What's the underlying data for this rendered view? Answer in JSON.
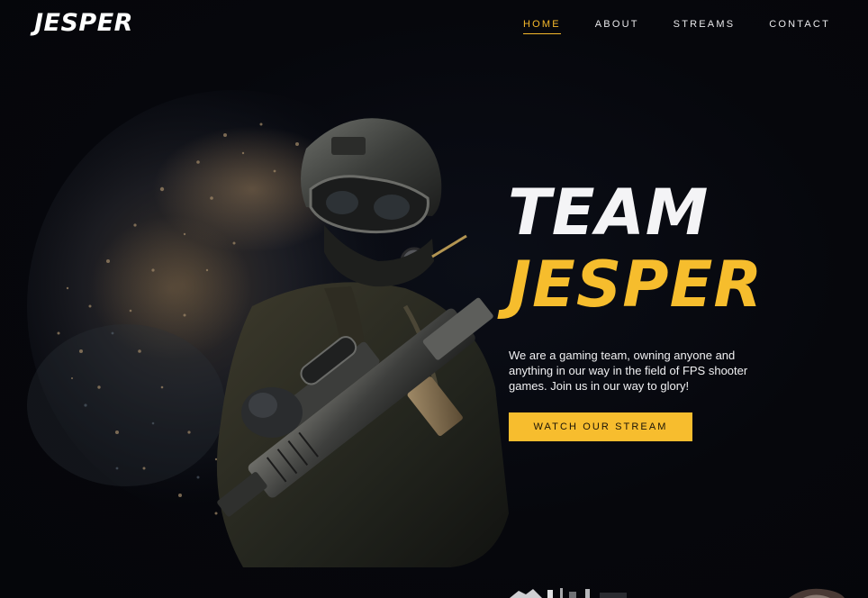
{
  "brand": {
    "logo_text": "JESPER"
  },
  "nav": {
    "items": [
      {
        "label": "HOME",
        "active": true
      },
      {
        "label": "ABOUT",
        "active": false
      },
      {
        "label": "STREAMS",
        "active": false
      },
      {
        "label": "CONTACT",
        "active": false
      }
    ]
  },
  "hero": {
    "title_line1": "TEAM",
    "title_line2": "JESPER",
    "description": "We are a gaming team, owning anyone and anything in our way in the field of FPS shooter games. Join us in our way to glory!",
    "cta_label": "WATCH OUR STREAM",
    "image_icon": "armed-soldier-dispersion-art"
  },
  "colors": {
    "background": "#06070c",
    "accent": "#f6bd2d",
    "text": "#f4f4f6"
  }
}
